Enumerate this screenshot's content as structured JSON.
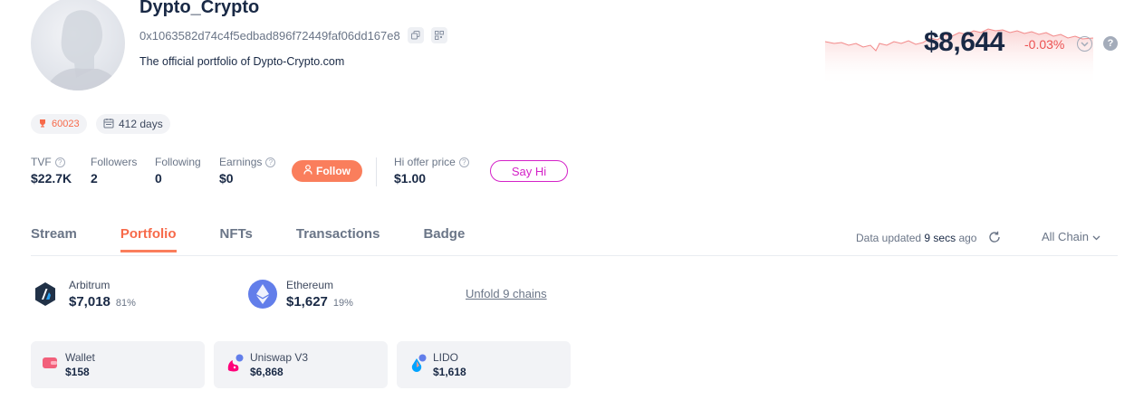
{
  "profile": {
    "name": "Dypto_Crypto",
    "address": "0x1063582d74c4f5edbad896f72449faf06dd167e8",
    "bio": "The official portfolio of Dypto-Crypto.com"
  },
  "net_worth": {
    "value": "$8,644",
    "change": "-0.03%",
    "help_icon": "?"
  },
  "badges": {
    "rank": "60023",
    "days": "412 days"
  },
  "stats": [
    {
      "label": "TVF",
      "value": "$22.7K"
    },
    {
      "label": "Followers",
      "value": "2"
    },
    {
      "label": "Following",
      "value": "0"
    },
    {
      "label": "Earnings",
      "value": "$0"
    }
  ],
  "follow_label": "Follow",
  "offer": {
    "label": "Hi offer price",
    "value": "$1.00"
  },
  "sayhi_label": "Say Hi",
  "tabs": [
    "Stream",
    "Portfolio",
    "NFTs",
    "Transactions",
    "Badge"
  ],
  "active_tab": "Portfolio",
  "data_updated": {
    "prefix": "Data updated",
    "time": "9 secs",
    "suffix": "ago"
  },
  "chain_filter": "All Chain",
  "chains": [
    {
      "name": "Arbitrum",
      "value": "$7,018",
      "pct": "81%",
      "icon": "arbitrum-icon"
    },
    {
      "name": "Ethereum",
      "value": "$1,627",
      "pct": "19%",
      "icon": "ethereum-icon"
    }
  ],
  "unfold_label": "Unfold 9 chains",
  "protocols": [
    {
      "name": "Wallet",
      "value": "$158",
      "icon": "wallet-icon"
    },
    {
      "name": "Uniswap V3",
      "value": "$6,868",
      "icon": "uniswap-icon"
    },
    {
      "name": "LIDO",
      "value": "$1,618",
      "icon": "lido-icon"
    }
  ],
  "colors": {
    "accent": "#fa7e5c",
    "negative": "#ec5151",
    "sayhi": "#d422c8",
    "text": "#192945",
    "muted": "#6a7587"
  }
}
